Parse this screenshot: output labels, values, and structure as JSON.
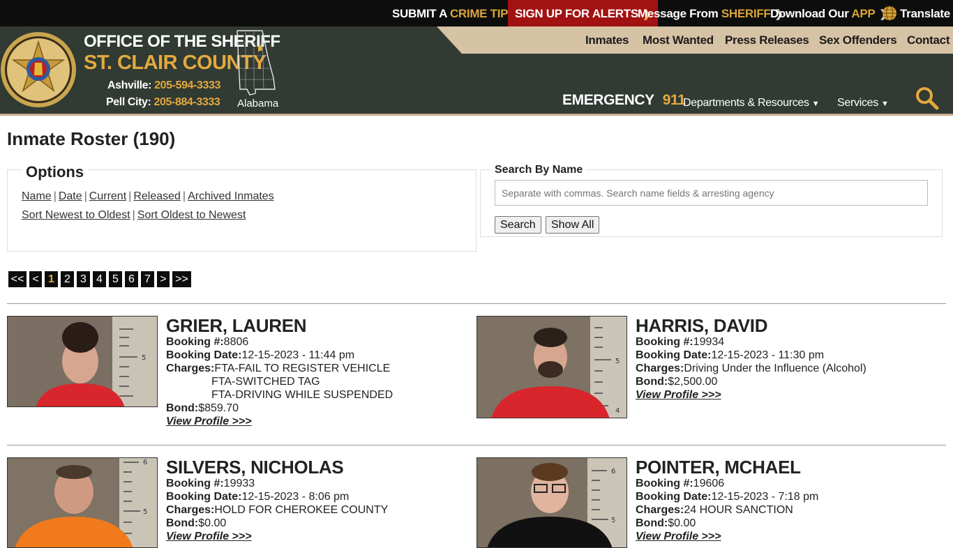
{
  "topbar": {
    "crime_tip_a": "SUBMIT A ",
    "crime_tip_b": "CRIME TIP",
    "alerts": "SIGN UP FOR ALERTS",
    "message_a": "Message From ",
    "message_b": "SHERIFF",
    "app_a": "Download Our ",
    "app_b": "APP",
    "translate": "Translate"
  },
  "header": {
    "title": "OFFICE OF THE SHERIFF",
    "county": "ST. CLAIR COUNTY",
    "ashville_label": "Ashville:",
    "ashville_phone": "205-594-3333",
    "pell_label": "Pell City:",
    "pell_phone": "205-884-3333",
    "state": "Alabama",
    "badge_text_top": "ST. CLAIR COUNTY",
    "badge_text_bottom": "SHERIFF",
    "emergency_label": "EMERGENCY",
    "emergency_number": "911",
    "nav": [
      "Inmates",
      "Most Wanted",
      "Press Releases",
      "Sex Offenders",
      "Contact"
    ],
    "nav2": [
      "Departments & Resources",
      "Services"
    ]
  },
  "page": {
    "title": "Inmate Roster (190)"
  },
  "options": {
    "legend": "Options",
    "filters": [
      "Name",
      "Date",
      "Current",
      "Released",
      "Archived Inmates"
    ],
    "sorts": [
      "Sort Newest to Oldest",
      "Sort Oldest to Newest"
    ]
  },
  "search": {
    "legend": "Search By Name",
    "placeholder": "Separate with commas. Search name fields & arresting agency",
    "search_label": "Search",
    "show_all_label": "Show All"
  },
  "pager": {
    "items": [
      "<<",
      "<",
      "1",
      "2",
      "3",
      "4",
      "5",
      "6",
      "7",
      ">",
      ">>"
    ],
    "current": "1"
  },
  "labels": {
    "booking_no": "Booking #:",
    "booking_date": "Booking Date:",
    "charges": "Charges:",
    "bond": "Bond:",
    "view_profile": "View Profile >>>"
  },
  "inmates": [
    {
      "name": "GRIER, LAUREN",
      "booking_no": "8806",
      "booking_date": "12-15-2023 - 11:44 pm",
      "charges": [
        "FTA-FAIL TO REGISTER VEHICLE",
        "FTA-SWITCHED TAG",
        "FTA-DRIVING WHILE SUSPENDED"
      ],
      "bond": "$859.70",
      "shirt_color": "#d8262c",
      "hair_color": "#2a1d18"
    },
    {
      "name": "HARRIS, DAVID",
      "booking_no": "19934",
      "booking_date": "12-15-2023 - 11:30 pm",
      "charges": [
        "Driving Under the Influence (Alcohol)"
      ],
      "bond": "$2,500.00",
      "shirt_color": "#d8262c",
      "hair_color": "#2b211b"
    },
    {
      "name": "SILVERS, NICHOLAS",
      "booking_no": "19933",
      "booking_date": "12-15-2023 - 8:06 pm",
      "charges": [
        "HOLD FOR CHEROKEE COUNTY"
      ],
      "bond": "$0.00",
      "shirt_color": "#f07a1c",
      "hair_color": "#4a3a2e"
    },
    {
      "name": "POINTER, MCHAEL",
      "booking_no": "19606",
      "booking_date": "12-15-2023 - 7:18 pm",
      "charges": [
        "24 HOUR SANCTION"
      ],
      "bond": "$0.00",
      "shirt_color": "#111111",
      "hair_color": "#5a3b22"
    }
  ]
}
